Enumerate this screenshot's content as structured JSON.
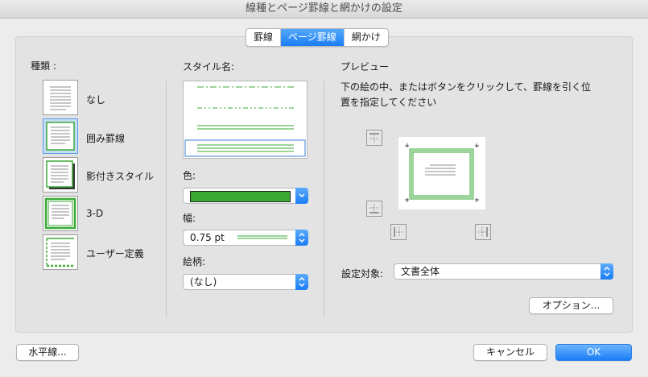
{
  "window": {
    "title": "線種とページ罫線と網かけの設定"
  },
  "tabs": [
    {
      "label": "罫線",
      "active": false
    },
    {
      "label": "ページ罫線",
      "active": true
    },
    {
      "label": "網かけ",
      "active": false
    }
  ],
  "kind": {
    "heading": "種類 :",
    "options": [
      {
        "label": "なし",
        "icon": "no-border-icon",
        "selected": false
      },
      {
        "label": "囲み罫線",
        "icon": "box-border-icon",
        "selected": true
      },
      {
        "label": "影付きスタイル",
        "icon": "shadow-border-icon",
        "selected": false
      },
      {
        "label": "3-D",
        "icon": "3d-border-icon",
        "selected": false
      },
      {
        "label": "ユーザー定義",
        "icon": "custom-border-icon",
        "selected": false
      }
    ]
  },
  "style": {
    "heading": "スタイル名:",
    "color_label": "色:",
    "color_value": "#3aaa35",
    "width_label": "幅:",
    "width_value": "0.75 pt",
    "art_label": "絵柄:",
    "art_value": "(なし)"
  },
  "preview": {
    "heading": "プレビュー",
    "instruction_line1": "下の絵の中、またはボタンをクリックして、罫線を引く位",
    "instruction_line2": "置を指定してください",
    "apply_label": "設定対象:",
    "apply_value": "文書全体",
    "options_button": "オプション..."
  },
  "footer": {
    "horizontal_line_button": "水平線...",
    "cancel_button": "キャンセル",
    "ok_button": "OK"
  },
  "colors": {
    "accent": "#1a7ef7",
    "border_green": "#3aaa35"
  }
}
